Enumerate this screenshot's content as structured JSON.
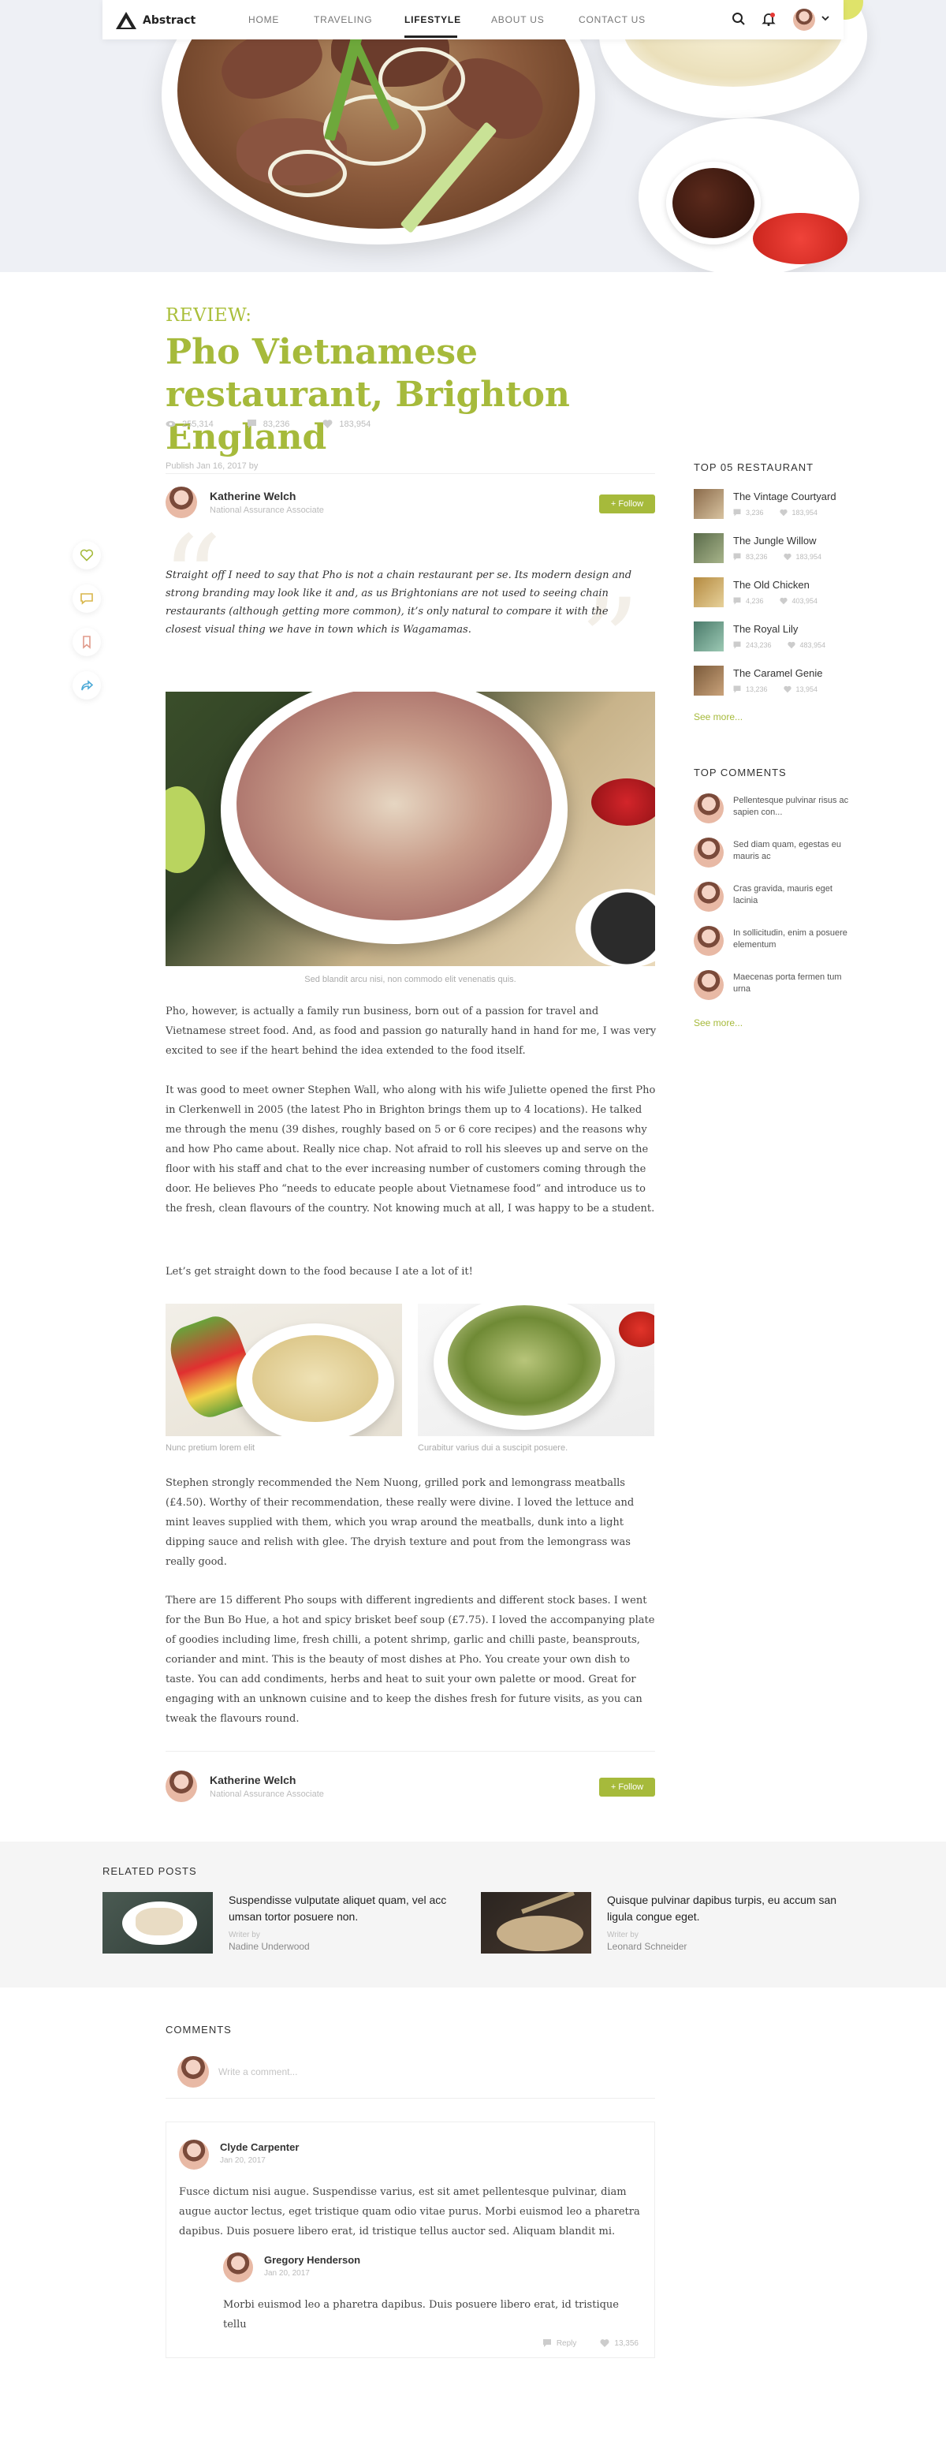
{
  "nav": {
    "logo": "Abstract",
    "items": [
      "HOME",
      "TRAVELING",
      "LIFESTYLE",
      "ABOUT US",
      "CONTACT US"
    ],
    "active_index": 2
  },
  "article": {
    "eyebrow": "REVIEW:",
    "title": "Pho Vietnamese restaurant, Brighton England",
    "stats": {
      "views": "255,314",
      "comments": "83,236",
      "likes": "183,954"
    },
    "publish": "Publish Jan 16, 2017 by",
    "author": {
      "name": "Katherine Welch",
      "role": "National Assurance Associate"
    },
    "follow_label": "+ Follow",
    "quote": "Straight off I need to say that Pho is not a chain restaurant per se. Its modern design and strong branding may look like it and, as us Brightonians are not used to seeing chain restaurants (although getting more common), it’s only natural to compare it with the closest visual thing we have in town which is Wagamamas.",
    "main_caption": "Sed blandit arcu nisi, non commodo elit venenatis quis.",
    "para1": "Pho, however, is actually a family run business, born out of a passion for travel and Vietnamese street food. And, as food and passion go naturally hand in hand for me, I was very excited to see if the heart behind the idea extended to the food itself.",
    "para2": "It was good to meet owner Stephen Wall, who along with his wife Juliette opened the first Pho in Clerkenwell in 2005 (the latest Pho in Brighton brings them up to 4 locations). He talked me through the menu (39 dishes, roughly based on 5 or 6 core recipes) and the reasons why and how Pho came about. Really nice chap. Not afraid to roll his sleeves up and serve on the floor with his staff and chat to the ever increasing number of customers coming through the door. He believes Pho “needs to educate people about Vietnamese food” and introduce us to the fresh, clean flavours of the country. Not knowing much at all, I was happy to be a student.",
    "para3": "Let’s get straight down to the food because I ate a lot of it!",
    "caption_a": "Nunc pretium lorem elit",
    "caption_b": "Curabitur varius dui a suscipit posuere.",
    "para4": "Stephen strongly recommended the Nem Nuong, grilled pork and lemongrass meatballs (£4.50). Worthy of their recommendation, these really were divine. I loved the lettuce and mint leaves supplied with them, which you wrap around the meatballs, dunk into a light dipping sauce and relish with glee. The dryish texture and pout from the lemongrass was really good.",
    "para5": "There are 15 different Pho soups with different ingredients and different stock bases. I went for the Bun Bo Hue, a hot and spicy brisket beef soup (£7.75). I loved the accompanying plate of goodies including lime, fresh chilli, a potent shrimp, garlic and chilli paste, beansprouts, coriander and mint. This is the beauty of most dishes at Pho. You create your own dish to taste. You can add condiments, herbs and heat to suit your own palette or mood. Great for engaging with an unknown cuisine and to keep the dishes fresh for future visits, as you can tweak the flavours round."
  },
  "sidebar": {
    "top_title": "TOP 05 RESTAURANT",
    "restaurants": [
      {
        "name": "The Vintage Courtyard",
        "comments": "3,236",
        "likes": "183,954"
      },
      {
        "name": "The Jungle Willow",
        "comments": "83,236",
        "likes": "183,954"
      },
      {
        "name": "The Old Chicken",
        "comments": "4,236",
        "likes": "403,954"
      },
      {
        "name": "The Royal Lily",
        "comments": "243,236",
        "likes": "483,954"
      },
      {
        "name": "The Caramel Genie",
        "comments": "13,236",
        "likes": "13,954"
      }
    ],
    "see_more": "See more...",
    "comments_title": "TOP COMMENTS",
    "top_comments": [
      "Pellentesque pulvinar risus ac sapien con...",
      "Sed diam quam, egestas eu mauris ac",
      "Cras gravida, mauris eget lacinia",
      "In sollicitudin, enim a posuere elementum",
      "Maecenas porta fermen tum urna"
    ]
  },
  "related": {
    "title": "RELATED POSTS",
    "writer_label": "Writer by",
    "posts": [
      {
        "title": "Suspendisse vulputate aliquet quam, vel acc umsan tortor posuere non.",
        "author": "Nadine Underwood"
      },
      {
        "title": "Quisque pulvinar dapibus turpis, eu accum san ligula congue eget.",
        "author": "Leonard Schneider"
      }
    ]
  },
  "comments": {
    "title": "COMMENTS",
    "placeholder": "Write a comment...",
    "items": [
      {
        "name": "Clyde Carpenter",
        "date": "Jan 20, 2017",
        "text": "Fusce dictum nisi augue. Suspendisse varius, est sit amet pellentesque pulvinar, diam augue auctor lectus, eget tristique quam odio vitae purus. Morbi euismod leo a pharetra dapibus. Duis posuere libero erat, id tristique tellus auctor sed. Aliquam blandit mi."
      },
      {
        "name": "Gregory Henderson",
        "date": "Jan 20, 2017",
        "text": "Morbi euismod leo a pharetra dapibus. Duis posuere libero erat, id tristique tellu"
      }
    ],
    "reply_label": "Reply",
    "like_count": "13,356"
  },
  "colors": {
    "accent": "#a6ba3b",
    "text": "#333333",
    "muted": "#bbbbbb"
  }
}
